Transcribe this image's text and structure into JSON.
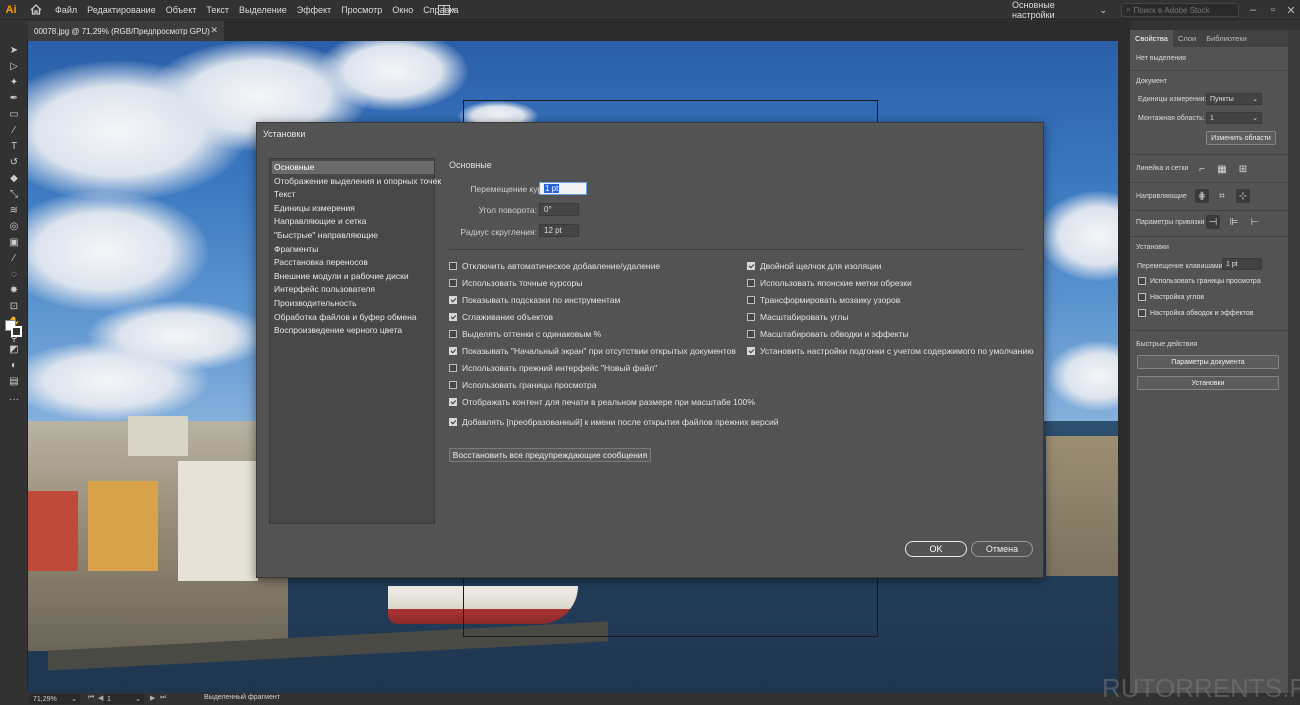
{
  "app": {
    "logo": "Ai"
  },
  "menu": [
    "Файл",
    "Редактирование",
    "Объект",
    "Текст",
    "Выделение",
    "Эффект",
    "Просмотр",
    "Окно",
    "Справка"
  ],
  "workspace": "Основные настройки",
  "search_placeholder": "Поиск в Adobe Stock",
  "document_tab": "00078.jpg @ 71,29% (RGB/Предпросмотр GPU)",
  "dialog": {
    "title": "Установки",
    "nav": [
      "Основные",
      "Отображение выделения и опорных точек",
      "Текст",
      "Единицы измерения",
      "Направляющие и сетка",
      "\"Быстрые\" направляющие",
      "Фрагменты",
      "Расстановка переносов",
      "Внешние модули и рабочие диски",
      "Интерфейс пользователя",
      "Производительность",
      "Обработка файлов и буфер обмена",
      "Воспроизведение черного цвета"
    ],
    "selected_nav": 0,
    "section_title": "Основные",
    "fields": {
      "cursor_label": "Перемещение курсора:",
      "cursor_value": "1 pt",
      "angle_label": "Угол поворота:",
      "angle_value": "0°",
      "radius_label": "Радиус скругления:",
      "radius_value": "12 pt"
    },
    "checkboxes_left": [
      {
        "label": "Отключить автоматическое добавление/удаление",
        "checked": false
      },
      {
        "label": "Использовать точные курсоры",
        "checked": false
      },
      {
        "label": "Показывать подсказки по инструментам",
        "checked": true
      },
      {
        "label": "Сглаживание объектов",
        "checked": true
      },
      {
        "label": "Выделять оттенки с одинаковым %",
        "checked": false
      },
      {
        "label": "Показывать \"Начальный экран\" при отсутствии открытых документов",
        "checked": true
      },
      {
        "label": "Использовать прежний интерфейс \"Новый файл\"",
        "checked": false
      },
      {
        "label": "Использовать границы просмотра",
        "checked": false
      },
      {
        "label": "Отображать контент для печати в реальном размере при масштабе 100%",
        "checked": true
      },
      {
        "label": "Добавлять [преобразованный] к имени после открытия файлов прежних версий",
        "checked": true
      }
    ],
    "checkboxes_right": [
      {
        "label": "Двойной щелчок для изоляции",
        "checked": true
      },
      {
        "label": "Использовать японские метки обрезки",
        "checked": false
      },
      {
        "label": "Трансформировать мозаику узоров",
        "checked": false
      },
      {
        "label": "Масштабировать углы",
        "checked": false
      },
      {
        "label": "Масштабировать обводки и эффекты",
        "checked": false
      },
      {
        "label": "Установить настройки подгонки с учетом содержимого по умолчанию",
        "checked": true
      }
    ],
    "reset_button": "Восстановить все предупреждающие сообщения",
    "ok": "OK",
    "cancel": "Отмена"
  },
  "panel": {
    "tabs": [
      "Свойства",
      "Слои",
      "Библиотеки"
    ],
    "no_selection": "Нет выделения",
    "document_heading": "Документ",
    "units_label": "Единицы измерения:",
    "units_value": "Пункты",
    "artboard_label": "Монтажная область:",
    "artboard_value": "1",
    "edit_artboards": "Изменить области",
    "rulers_label": "Линейка и сетки",
    "guides_label": "Направляющие",
    "snap_label": "Параметры привязки",
    "prefs_heading": "Установки",
    "keyboard_label": "Перемещение клавишами:",
    "keyboard_value": "1 pt",
    "cb_preview_bounds": "Использовать границы просмотра",
    "cb_scale_corners": "Настройка углов",
    "cb_scale_strokes": "Настройка обводок и эффектов",
    "quick_heading": "Быстрые действия",
    "doc_setup": "Параметры документа",
    "preferences": "Установки"
  },
  "status": {
    "zoom": "71,29%",
    "page": "1",
    "info": "Выделенный фрагмент"
  },
  "watermark": "RUTORRENTS.RU"
}
